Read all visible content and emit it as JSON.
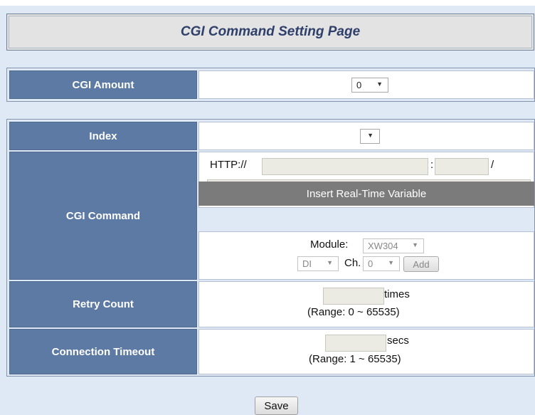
{
  "page": {
    "title": "CGI Command Setting Page"
  },
  "cgi_amount": {
    "label": "CGI Amount",
    "value": "0"
  },
  "form": {
    "index": {
      "label": "Index",
      "value": ""
    },
    "cgi_command": {
      "label": "CGI Command",
      "http_prefix": "HTTP://",
      "host_value": "",
      "colon": ":",
      "port_value": "",
      "slash": "/",
      "path_value": "",
      "insert_bar_label": "Insert Real-Time Variable",
      "module_label": "Module:",
      "module_value": "XW304",
      "type_value": "DI",
      "ch_label": "Ch.",
      "ch_value": "0",
      "add_label": "Add"
    },
    "retry_count": {
      "label": "Retry Count",
      "value": "",
      "unit": "times",
      "range": "(Range: 0 ~ 65535)"
    },
    "connection_timeout": {
      "label": "Connection Timeout",
      "value": "",
      "unit": "secs",
      "range": "(Range: 1 ~ 65535)"
    }
  },
  "actions": {
    "save_label": "Save"
  },
  "icons": {
    "dropdown": "chevron-down-icon"
  }
}
